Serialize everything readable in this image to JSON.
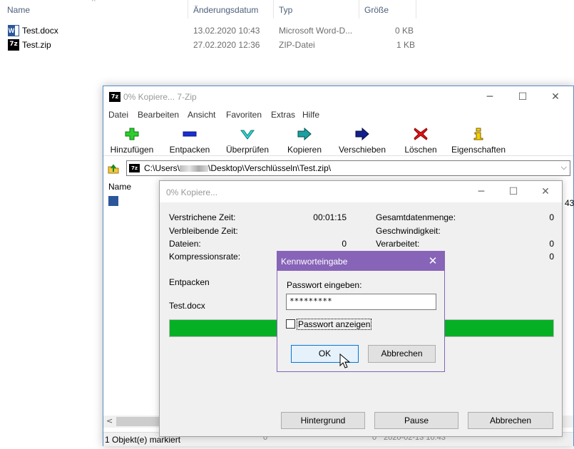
{
  "explorer": {
    "columns": [
      "Name",
      "Änderungsdatum",
      "Typ",
      "Größe"
    ],
    "files": [
      {
        "name": "Test.docx",
        "date": "13.02.2020 10:43",
        "type": "Microsoft Word-D...",
        "size": "0 KB",
        "icon": "word-document-icon"
      },
      {
        "name": "Test.zip",
        "date": "27.02.2020 12:36",
        "type": "ZIP-Datei",
        "size": "1 KB",
        "icon": "7zip-archive-icon"
      }
    ]
  },
  "zipwindow": {
    "title": "0% Kopiere... 7-Zip",
    "app_icon_text": "7z",
    "menu": [
      "Datei",
      "Bearbeiten",
      "Ansicht",
      "Favoriten",
      "Extras",
      "Hilfe"
    ],
    "toolbar": [
      "Hinzufügen",
      "Entpacken",
      "Überprüfen",
      "Kopieren",
      "Verschieben",
      "Löschen",
      "Eigenschaften"
    ],
    "address_prefix": "C:\\Users\\",
    "address_suffix": "\\Desktop\\Verschlüsseln\\Test.zip\\",
    "list_header": "Name",
    "status": "1 Objekt(e) markiert",
    "status_fragments": [
      "0",
      "0",
      "2020-02-13 10:43"
    ],
    "right_cut": "43"
  },
  "progress": {
    "title": "0% Kopiere...",
    "elapsed_label": "Verstrichene Zeit:",
    "elapsed_value": "00:01:15",
    "remaining_label": "Verbleibende Zeit:",
    "files_label": "Dateien:",
    "files_value": "0",
    "ratio_label": "Kompressionsrate:",
    "total_label": "Gesamtdatenmenge:",
    "total_value": "0",
    "speed_label": "Geschwindigkeit:",
    "processed_label": "Verarbeitet:",
    "processed_value": "0",
    "extra_value": "0",
    "action": "Entpacken",
    "current_file": "Test.docx",
    "progress_percent": 100,
    "buttons": {
      "background": "Hintergrund",
      "pause": "Pause",
      "cancel": "Abbrechen"
    }
  },
  "password": {
    "title": "Kennworteingabe",
    "label": "Passwort eingeben:",
    "value": "*********",
    "show_label": "Passwort anzeigen",
    "ok": "OK",
    "cancel": "Abbrechen",
    "accent": "#8764b8"
  }
}
